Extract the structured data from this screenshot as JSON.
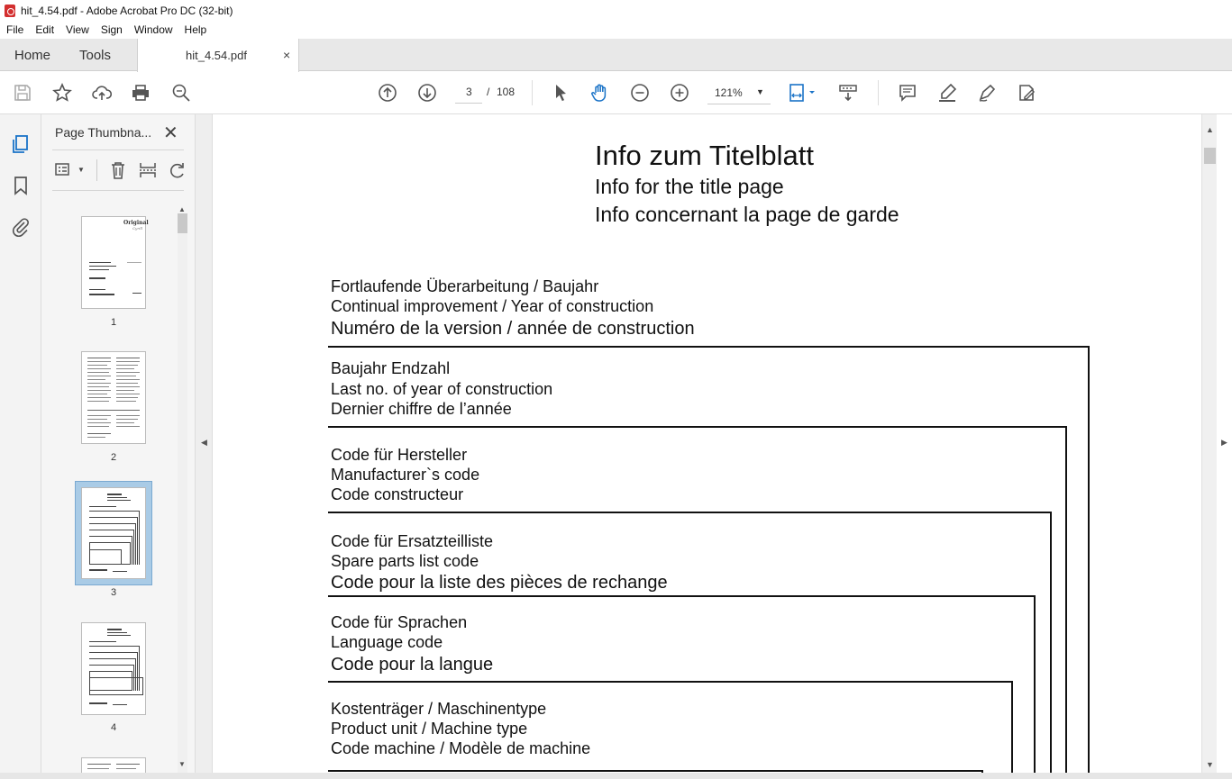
{
  "window": {
    "title": "hit_4.54.pdf - Adobe Acrobat Pro DC (32-bit)"
  },
  "menu": [
    "File",
    "Edit",
    "View",
    "Sign",
    "Window",
    "Help"
  ],
  "tabs": {
    "home": "Home",
    "tools": "Tools",
    "doc": "hit_4.54.pdf",
    "close": "×"
  },
  "toolbar": {
    "page_current": "3",
    "page_separator": "/",
    "page_total": "108",
    "zoom": "121%"
  },
  "thumbnails_panel": {
    "title": "Page Thumbna...",
    "close": "✕",
    "pages": [
      "1",
      "2",
      "3",
      "4"
    ],
    "selected_page": "3"
  },
  "document": {
    "title_de": "Info  zum  Titelblatt",
    "title_en": "Info for the title page",
    "title_fr": "Info concernant la page de garde",
    "sections": [
      {
        "de": "Fortlaufende Überarbeitung / Baujahr",
        "en": "Continual improvement / Year of construction",
        "fr": "Numéro de la version / année de construction"
      },
      {
        "de": "Baujahr Endzahl",
        "en": "Last no. of year of construction",
        "fr": "Dernier chiffre de l’année"
      },
      {
        "de": "Code für Hersteller",
        "en": "Manufacturer`s  code",
        "fr": "Code constructeur"
      },
      {
        "de": "Code für Ersatzteilliste",
        "en": "Spare parts list code",
        "fr": "Code pour la liste des pièces de rechange"
      },
      {
        "de": "Code für Sprachen",
        "en": "Language code",
        "fr": "Code pour la langue"
      },
      {
        "de": "Kostenträger / Maschinentype",
        "en": "Product unit / Machine type",
        "fr": "Code machine / Modèle de machine"
      }
    ]
  },
  "thumb1_text": {
    "line1": "Original",
    "line2": "Cyrill"
  },
  "colors": {
    "accent": "#1a73c7",
    "thumb_selected": "#a9cbe6",
    "pdf_red": "#d32f2f"
  }
}
